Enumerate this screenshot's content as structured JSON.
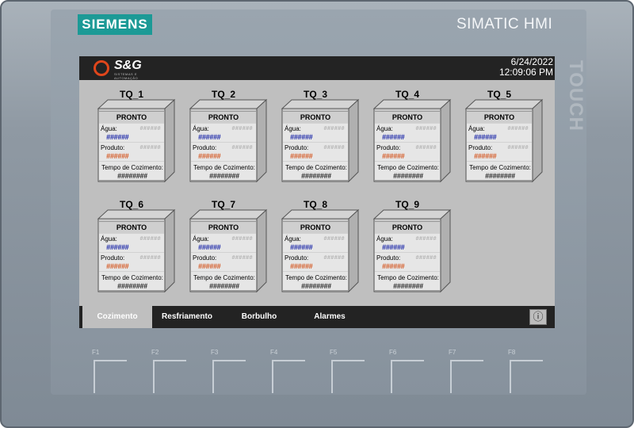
{
  "device": {
    "brand": "SIEMENS",
    "model": "SIMATIC HMI",
    "side_label": "TOUCH"
  },
  "header": {
    "logo_text": "S&G",
    "logo_sub": "SISTEMAS E AUTOMAÇÃO",
    "date": "6/24/2022",
    "time": "12:09:06 PM"
  },
  "tank_labels": {
    "agua": "Água:",
    "produto": "Produto:",
    "tempo": "Tempo de Cozimento:"
  },
  "placeholders": {
    "small": "######",
    "long": "########"
  },
  "tanks": [
    {
      "name": "TQ_1",
      "status": "PRONTO",
      "agua_value": "######",
      "produto_value": "######",
      "tempo_value": "########"
    },
    {
      "name": "TQ_2",
      "status": "PRONTO",
      "agua_value": "######",
      "produto_value": "######",
      "tempo_value": "########"
    },
    {
      "name": "TQ_3",
      "status": "PRONTO",
      "agua_value": "######",
      "produto_value": "######",
      "tempo_value": "########"
    },
    {
      "name": "TQ_4",
      "status": "PRONTO",
      "agua_value": "######",
      "produto_value": "######",
      "tempo_value": "########"
    },
    {
      "name": "TQ_5",
      "status": "PRONTO",
      "agua_value": "######",
      "produto_value": "######",
      "tempo_value": "########"
    },
    {
      "name": "TQ_6",
      "status": "PRONTO",
      "agua_value": "######",
      "produto_value": "######",
      "tempo_value": "########"
    },
    {
      "name": "TQ_7",
      "status": "PRONTO",
      "agua_value": "######",
      "produto_value": "######",
      "tempo_value": "########"
    },
    {
      "name": "TQ_8",
      "status": "PRONTO",
      "agua_value": "######",
      "produto_value": "######",
      "tempo_value": "########"
    },
    {
      "name": "TQ_9",
      "status": "PRONTO",
      "agua_value": "######",
      "produto_value": "######",
      "tempo_value": "########"
    }
  ],
  "nav": {
    "items": [
      "Cozimento",
      "Resfriamento",
      "Borbulho",
      "Alarmes"
    ],
    "active": "Cozimento",
    "info_icon": "info-circle-icon"
  },
  "function_keys": [
    "F1",
    "F2",
    "F3",
    "F4",
    "F5",
    "F6",
    "F7",
    "F8"
  ],
  "colors": {
    "brand": "#1c9a96",
    "water_value": "#1420a6",
    "product_value": "#d4541d",
    "logo_accent": "#e0461b"
  }
}
